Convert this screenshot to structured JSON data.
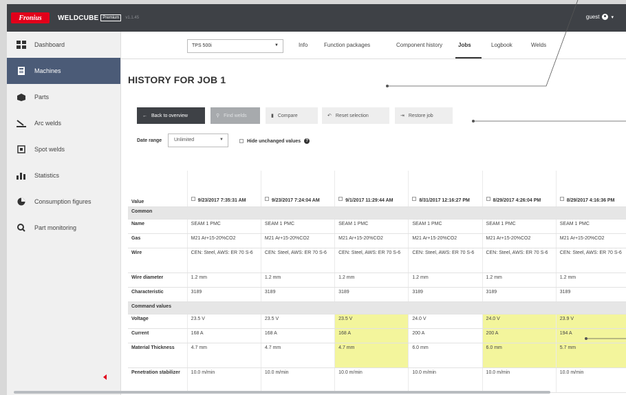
{
  "topbar": {
    "logo_text": "Fronius",
    "app_name": "WELDCUBE",
    "premium_label": "Premium",
    "version": "v1.1.45",
    "user": "guest"
  },
  "sidebar": {
    "items": [
      {
        "label": "Dashboard",
        "icon": "dashboard-icon"
      },
      {
        "label": "Machines",
        "icon": "machine-icon"
      },
      {
        "label": "Parts",
        "icon": "parts-icon"
      },
      {
        "label": "Arc welds",
        "icon": "arc-weld-icon"
      },
      {
        "label": "Spot welds",
        "icon": "spot-weld-icon"
      },
      {
        "label": "Statistics",
        "icon": "statistics-icon"
      },
      {
        "label": "Consumption figures",
        "icon": "pie-chart-icon"
      },
      {
        "label": "Part monitoring",
        "icon": "search-icon"
      }
    ],
    "active": "Machines"
  },
  "subnav": {
    "machine_select": "TPS 500i",
    "tabs": [
      "Info",
      "Function packages",
      "Component history",
      "Jobs",
      "Logbook",
      "Welds"
    ],
    "active_tab": "Jobs"
  },
  "page": {
    "title": "HISTORY FOR JOB 1"
  },
  "toolbar": {
    "back_label": "Back to overview",
    "find_welds_label": "Find welds",
    "compare_label": "Compare",
    "reset_label": "Reset selection",
    "restore_label": "Restore job"
  },
  "filters": {
    "date_range_label": "Date range",
    "date_range_value": "Unlimited",
    "hide_unchanged_label": "Hide unchanged values"
  },
  "table": {
    "value_header": "Value",
    "columns": [
      "9/23/2017 7:35:31 AM",
      "9/23/2017 7:24:04 AM",
      "9/1/2017 11:29:44 AM",
      "8/31/2017 12:16:27 PM",
      "8/29/2017 4:26:04 PM",
      "8/29/2017 4:16:36 PM"
    ],
    "sections": [
      {
        "title": "Common",
        "rows": [
          {
            "label": "Name",
            "values": [
              "SEAM 1 PMC",
              "SEAM 1 PMC",
              "SEAM 1 PMC",
              "SEAM 1 PMC",
              "SEAM 1 PMC",
              "SEAM 1 PMC"
            ],
            "highlight": []
          },
          {
            "label": "Gas",
            "values": [
              "M21 Ar+15-20%CO2",
              "M21 Ar+15-20%CO2",
              "M21 Ar+15-20%CO2",
              "M21 Ar+15-20%CO2",
              "M21 Ar+15-20%CO2",
              "M21 Ar+15-20%CO2"
            ],
            "highlight": []
          },
          {
            "label": "Wire",
            "values": [
              "CEN: Steel, AWS: ER 70 S-6",
              "CEN: Steel, AWS: ER 70 S-6",
              "CEN: Steel, AWS: ER 70 S-6",
              "CEN: Steel, AWS: ER 70 S-6",
              "CEN: Steel, AWS: ER 70 S-6",
              "CEN: Steel, AWS: ER 70 S-6"
            ],
            "highlight": []
          },
          {
            "label": "Wire diameter",
            "values": [
              "1.2 mm",
              "1.2 mm",
              "1.2 mm",
              "1.2 mm",
              "1.2 mm",
              "1.2 mm"
            ],
            "highlight": []
          },
          {
            "label": "Characteristic",
            "values": [
              "3189",
              "3189",
              "3189",
              "3189",
              "3189",
              "3189"
            ],
            "highlight": []
          }
        ]
      },
      {
        "title": "Command values",
        "rows": [
          {
            "label": "Voltage",
            "values": [
              "23.5 V",
              "23.5 V",
              "23.5 V",
              "24.0 V",
              "24.0 V",
              "23.9 V"
            ],
            "highlight": [
              2,
              4,
              5
            ]
          },
          {
            "label": "Current",
            "values": [
              "168 A",
              "168 A",
              "168 A",
              "200 A",
              "200 A",
              "194 A"
            ],
            "highlight": [
              2,
              4,
              5
            ]
          },
          {
            "label": "Material Thickness",
            "values": [
              "4.7 mm",
              "4.7 mm",
              "4.7 mm",
              "6.0 mm",
              "6.0 mm",
              "5.7 mm"
            ],
            "highlight": [
              2,
              4,
              5
            ]
          },
          {
            "label": "Penetration stabilizer",
            "values": [
              "10.0 m/min",
              "10.0 m/min",
              "10.0 m/min",
              "10.0 m/min",
              "10.0 m/min",
              "10.0 m/min"
            ],
            "highlight": []
          }
        ]
      }
    ]
  },
  "colors": {
    "topbar": "#3e4146",
    "active_nav": "#4b5b77",
    "brand_red": "#e2001a",
    "highlight": "#f3f59c"
  }
}
